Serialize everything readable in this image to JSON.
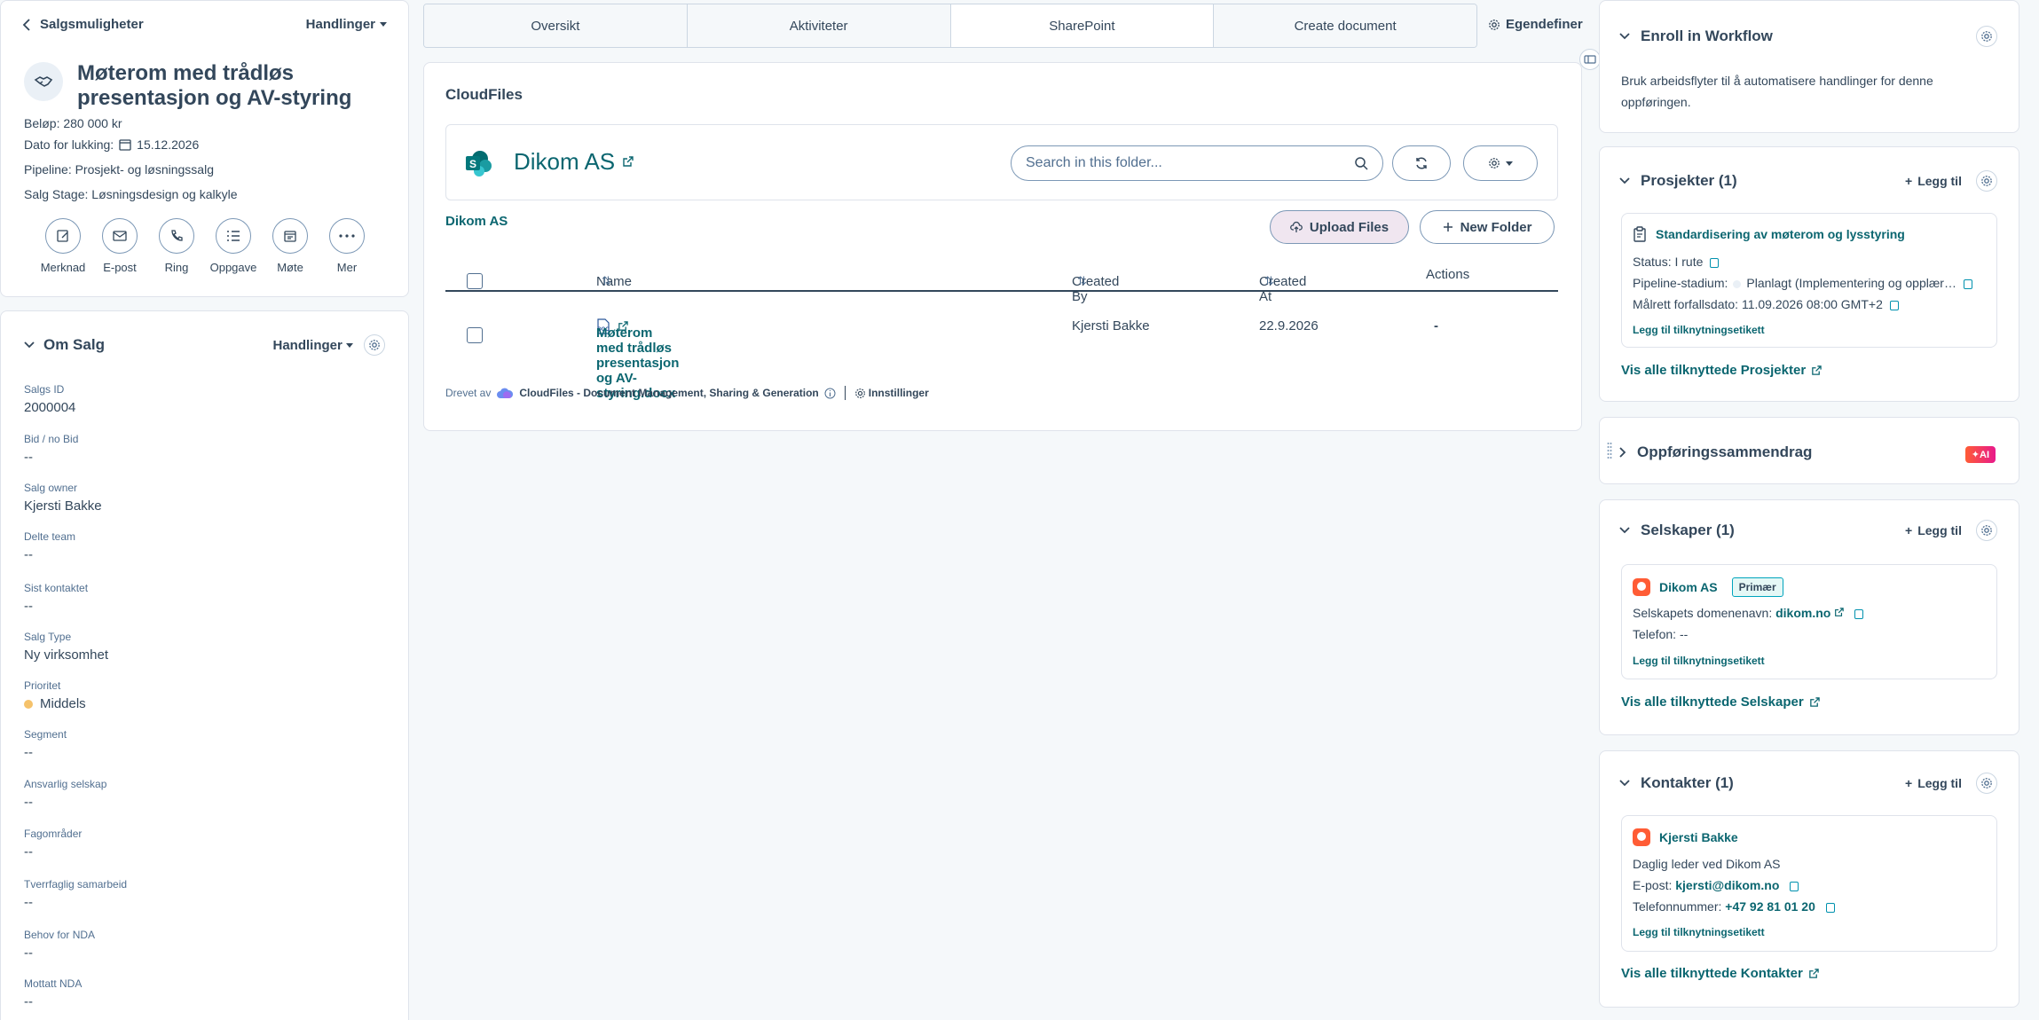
{
  "header": {
    "back_label": "Salgsmuligheter",
    "actions_label": "Handlinger"
  },
  "record": {
    "title": "Møterom med trådløs presentasjon og AV-styring",
    "amount_label": "Beløp:",
    "amount": "280 000 kr",
    "close_date_label": "Dato for lukking:",
    "close_date": "15.12.2026",
    "pipeline_label": "Pipeline:",
    "pipeline": "Prosjekt- og løsningssalg",
    "stage_label": "Salg Stage:",
    "stage": "Løsningsdesign og kalkyle"
  },
  "quick_actions": [
    {
      "label": "Merknad",
      "icon": "note-icon"
    },
    {
      "label": "E-post",
      "icon": "email-icon"
    },
    {
      "label": "Ring",
      "icon": "phone-icon"
    },
    {
      "label": "Oppgave",
      "icon": "task-icon"
    },
    {
      "label": "Møte",
      "icon": "calendar-icon"
    },
    {
      "label": "Mer",
      "icon": "more-icon"
    }
  ],
  "about": {
    "title": "Om Salg",
    "actions_label": "Handlinger",
    "props": [
      {
        "label": "Salgs ID",
        "value": "2000004"
      },
      {
        "label": "Bid / no Bid",
        "value": "--"
      },
      {
        "label": "Salg owner",
        "value": "Kjersti Bakke"
      },
      {
        "label": "Delte team",
        "value": "--"
      },
      {
        "label": "Sist kontaktet",
        "value": "--"
      },
      {
        "label": "Salg Type",
        "value": "Ny virksomhet"
      },
      {
        "label": "Prioritet",
        "value": "Middels"
      },
      {
        "label": "Segment",
        "value": "--"
      },
      {
        "label": "Ansvarlig selskap",
        "value": "--"
      },
      {
        "label": "Fagområder",
        "value": "--"
      },
      {
        "label": "Tverrfaglig samarbeid",
        "value": "--"
      },
      {
        "label": "Behov for NDA",
        "value": "--"
      },
      {
        "label": "Mottatt NDA",
        "value": "--"
      }
    ],
    "priority_color": "#f5c26b"
  },
  "tabs": [
    "Oversikt",
    "Aktiviteter",
    "SharePoint",
    "Create document"
  ],
  "active_tab": "SharePoint",
  "customize_label": "Egendefiner",
  "cloudfiles": {
    "title": "CloudFiles",
    "site_name": "Dikom AS",
    "search_placeholder": "Search in this folder...",
    "breadcrumb": "Dikom AS",
    "upload_label": "Upload Files",
    "new_folder_label": "New Folder",
    "columns": {
      "name": "Name",
      "created_by": "Created By",
      "created_at": "Created At",
      "actions": "Actions"
    },
    "files": [
      {
        "name": "Møterom med trådløs presentasjon og AV-styring.docx",
        "created_by": "Kjersti Bakke",
        "created_at": "22.9.2026",
        "actions": "-"
      }
    ],
    "powered_by": "Drevet av",
    "powered_app": "CloudFiles - Document Management, Sharing & Generation",
    "settings_label": "Innstillinger"
  },
  "workflow": {
    "title": "Enroll in Workflow",
    "description": "Bruk arbeidsflyter til å automatisere handlinger for denne oppføringen."
  },
  "projects": {
    "title": "Prosjekter (1)",
    "add_label": "Legg til",
    "item_name": "Standardisering av møterom og lysstyring",
    "status_label": "Status:",
    "status": "I rute",
    "stage_label": "Pipeline-stadium:",
    "stage": "Planlagt (Implementering og opplær…",
    "due_label": "Målrett forfallsdato:",
    "due": "11.09.2026 08:00 GMT+2",
    "assoc_label": "Legg til tilknytningsetikett",
    "view_all": "Vis alle tilknyttede Prosjekter"
  },
  "summary": {
    "title": "Oppføringssammendrag",
    "ai_badge": "✦AI"
  },
  "companies": {
    "title": "Selskaper (1)",
    "add_label": "Legg til",
    "name": "Dikom AS",
    "badge": "Primær",
    "domain_label": "Selskapets domenenavn:",
    "domain": "dikom.no",
    "phone_label": "Telefon:",
    "phone": "--",
    "assoc_label": "Legg til tilknytningsetikett",
    "view_all": "Vis alle tilknyttede Selskaper"
  },
  "contacts": {
    "title": "Kontakter (1)",
    "add_label": "Legg til",
    "name": "Kjersti Bakke",
    "role": "Daglig leder ved Dikom AS",
    "email_label": "E-post:",
    "email": "kjersti@dikom.no",
    "phone_label": "Telefonnummer:",
    "phone": "+47 92 81 01 20",
    "assoc_label": "Legg til tilknytningsetikett",
    "view_all": "Vis alle tilknyttede Kontakter"
  }
}
